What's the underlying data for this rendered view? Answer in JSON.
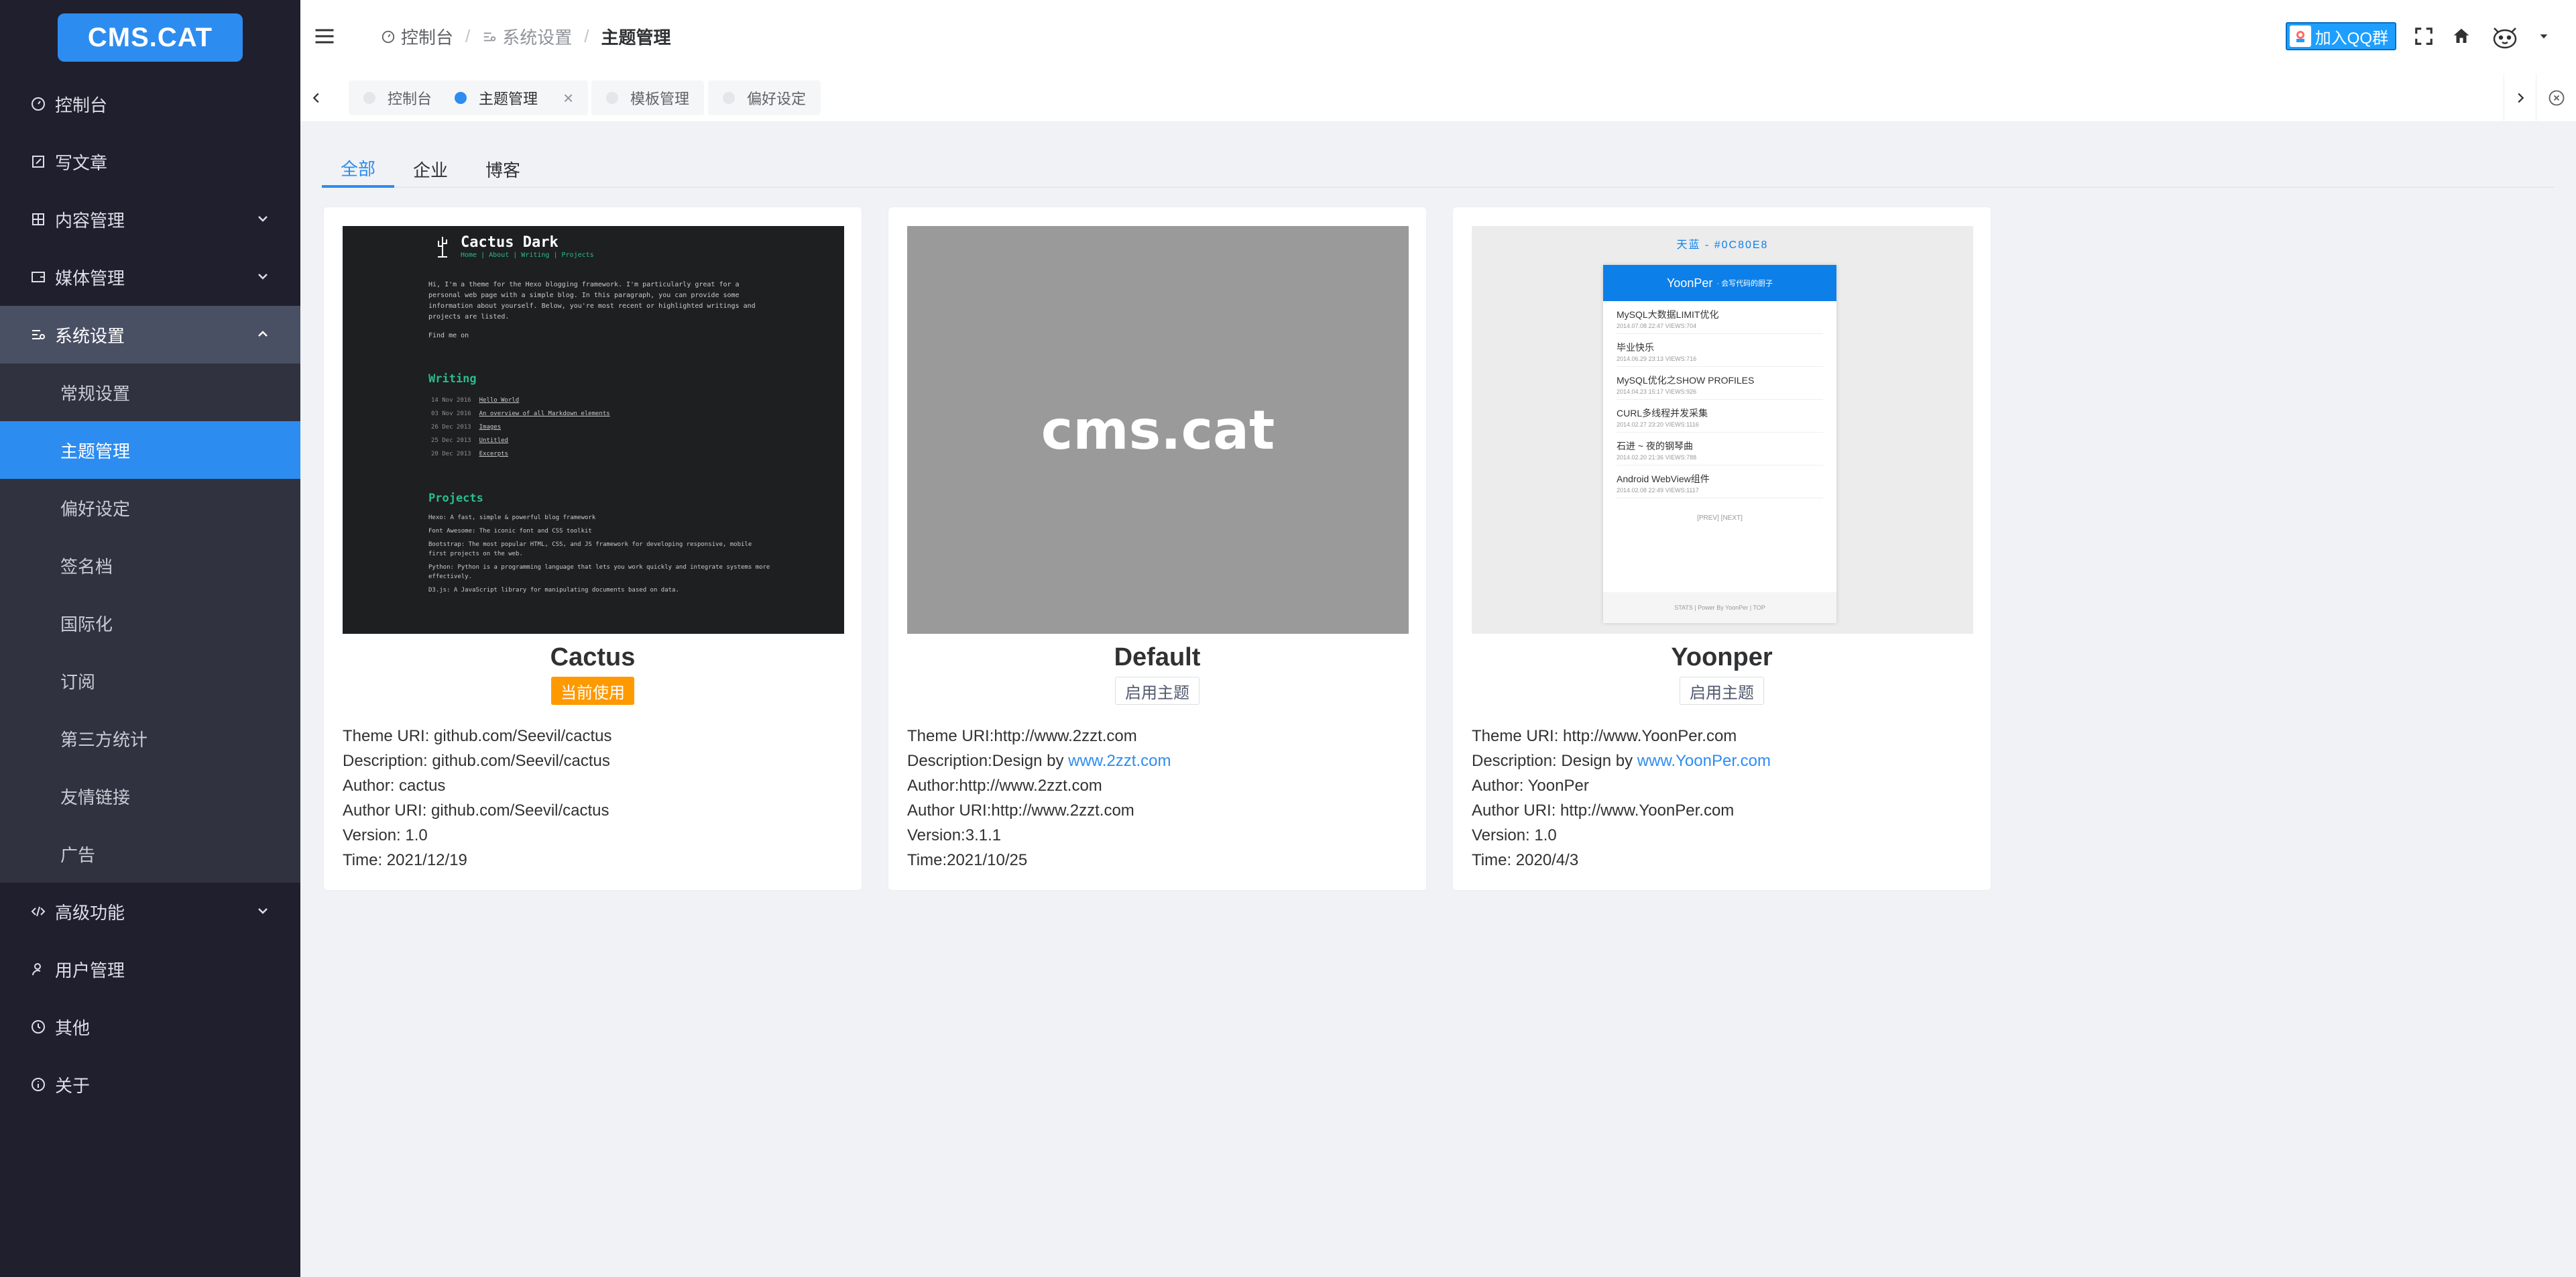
{
  "brand": {
    "logo_text": "CMS.CAT"
  },
  "sidebar": {
    "items": [
      {
        "label": "控制台",
        "icon": "gauge-icon"
      },
      {
        "label": "写文章",
        "icon": "edit-icon"
      },
      {
        "label": "内容管理",
        "icon": "grid-icon"
      },
      {
        "label": "媒体管理",
        "icon": "media-icon"
      },
      {
        "label": "系统设置",
        "icon": "settings-list-icon"
      },
      {
        "label": "高级功能",
        "icon": "code-icon"
      },
      {
        "label": "用户管理",
        "icon": "user-icon"
      },
      {
        "label": "其他",
        "icon": "clock-icon"
      },
      {
        "label": "关于",
        "icon": "info-icon"
      }
    ],
    "sub_items": [
      "常规设置",
      "主题管理",
      "偏好设定",
      "签名档",
      "国际化",
      "订阅",
      "第三方统计",
      "友情链接",
      "广告"
    ]
  },
  "header": {
    "breadcrumb": [
      "控制台",
      "系统设置",
      "主题管理"
    ],
    "qq_button": "加入QQ群"
  },
  "tabs": [
    {
      "label": "控制台"
    },
    {
      "label": "主题管理",
      "close": "×"
    },
    {
      "label": "模板管理"
    },
    {
      "label": "偏好设定"
    }
  ],
  "filter_tabs": [
    "全部",
    "企业",
    "博客"
  ],
  "themes": [
    {
      "name": "Cactus",
      "button": "当前使用",
      "meta": [
        "Theme URI: github.com/Seevil/cactus",
        "Description: github.com/Seevil/cactus",
        "Author: cactus",
        "Author URI: github.com/Seevil/cactus",
        "Version: 1.0",
        "Time: 2021/12/19"
      ],
      "preview": {
        "title": "Cactus Dark",
        "nav": "Home  |  About  |  Writing  |  Projects",
        "intro": "Hi, I'm a theme for the Hexo blogging framework. I'm particularly great for a personal web page with a simple blog. In this paragraph, you can provide some information about yourself. Below, you're most recent or highlighted writings and projects are listed.",
        "find": "Find me on",
        "writing_heading": "Writing",
        "writing": [
          {
            "date": "14 Nov 2016",
            "title": "Hello World"
          },
          {
            "date": "03 Nov 2016",
            "title": "An overview of all Markdown elements"
          },
          {
            "date": "26 Dec 2013",
            "title": "Images"
          },
          {
            "date": "25 Dec 2013",
            "title": "Untitled"
          },
          {
            "date": "20 Dec 2013",
            "title": "Excerpts"
          }
        ],
        "projects_heading": "Projects",
        "projects": [
          "Hexo: A fast, simple & powerful blog framework",
          "Font Awesome: The iconic font and CSS toolkit",
          "Bootstrap: The most popular HTML, CSS, and JS framework for developing responsive, mobile first projects on the web.",
          "Python: Python is a programming language that lets you work quickly and integrate systems more effectively.",
          "D3.js: A JavaScript library for manipulating documents based on data."
        ]
      }
    },
    {
      "name": "Default",
      "button": "启用主题",
      "meta_prefix": [
        "Theme URI:http://www.2zzt.com",
        "Description:Design by "
      ],
      "meta_link": "www.2zzt.com",
      "meta_rest": [
        "Author:http://www.2zzt.com",
        "Author URI:http://www.2zzt.com",
        "Version:3.1.1",
        "Time:2021/10/25"
      ],
      "preview": {
        "text": "cms.cat"
      }
    },
    {
      "name": "Yoonper",
      "button": "启用主题",
      "meta_prefix": [
        "Theme URI: http://www.YoonPer.com",
        "Description: Design by "
      ],
      "meta_link": "www.YoonPer.com",
      "meta_rest": [
        "Author: YoonPer",
        "Author URI: http://www.YoonPer.com",
        "Version: 1.0",
        "Time: 2020/4/3"
      ],
      "preview": {
        "head": "天蓝 - #0C80E8",
        "brand": "YoonPer",
        "tagline": "· 会写代码的厨子",
        "posts": [
          {
            "title": "MySQL大数据LIMIT优化",
            "meta": "2014.07.08 22:47  VIEWS:704"
          },
          {
            "title": "毕业快乐",
            "meta": "2014.06.29 23:13  VIEWS:716"
          },
          {
            "title": "MySQL优化之SHOW PROFILES",
            "meta": "2014.04.23 15:17  VIEWS:926"
          },
          {
            "title": "CURL多线程并发采集",
            "meta": "2014.02.27 23:20  VIEWS:1116"
          },
          {
            "title": "石进 ~ 夜的钢琴曲",
            "meta": "2014.02.20 21:36  VIEWS:788"
          },
          {
            "title": "Android WebView组件",
            "meta": "2014.02.08 22:49  VIEWS:1117"
          }
        ],
        "pager": "[PREV]    [NEXT]",
        "footer": "STATS  |  Power By YoonPer  |  TOP"
      }
    }
  ],
  "colors": {
    "primary": "#2d8cf0",
    "sidebar_bg": "#1f1f2e",
    "warning": "#ff9900"
  }
}
